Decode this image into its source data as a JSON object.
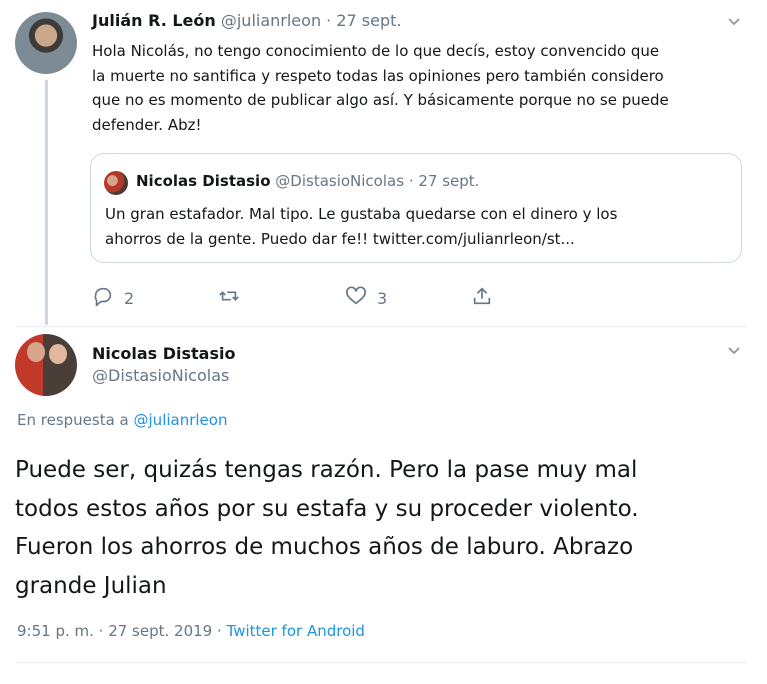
{
  "reply_tweet": {
    "author_name": "Julián R. León",
    "author_handle": "@julianrleon",
    "date": "· 27 sept.",
    "text_lines": [
      "Hola Nicolás, no tengo conocimiento de lo que decís, estoy convencido que",
      "la muerte no santifica y respeto todas las opiniones pero también considero",
      "que no es momento de publicar algo así. Y básicamente porque no se puede",
      "defender. Abz!"
    ],
    "quoted": {
      "author_name": "Nicolas Distasio",
      "author_handle": "@DistasioNicolas",
      "date": "· 27 sept.",
      "text_lines": [
        "Un gran estafador. Mal tipo. Le gustaba quedarse con el dinero y los",
        "ahorros de la gente. Puedo dar fe!! twitter.com/julianrleon/st..."
      ]
    },
    "actions": {
      "reply_count": "2",
      "retweet_count": "",
      "like_count": "3"
    }
  },
  "main_tweet": {
    "author_name": "Nicolas Distasio",
    "author_handle": "@DistasioNicolas",
    "reply_to_prefix": "En respuesta a ",
    "reply_to_handle": "@julianrleon",
    "text_lines": [
      "Puede ser, quizás tengas razón. Pero la pase muy mal",
      "todos estos años por su estafa y su proceder violento.",
      "Fueron los ahorros de muchos años de laburo. Abrazo",
      "grande Julian"
    ],
    "timestamp": "9:51 p. m. · 27 sept. 2019 · ",
    "source": "Twitter for Android"
  },
  "icons": {
    "chevron": "chevron-down-icon",
    "reply": "reply-icon",
    "retweet": "retweet-icon",
    "like": "heart-icon",
    "share": "share-icon"
  }
}
